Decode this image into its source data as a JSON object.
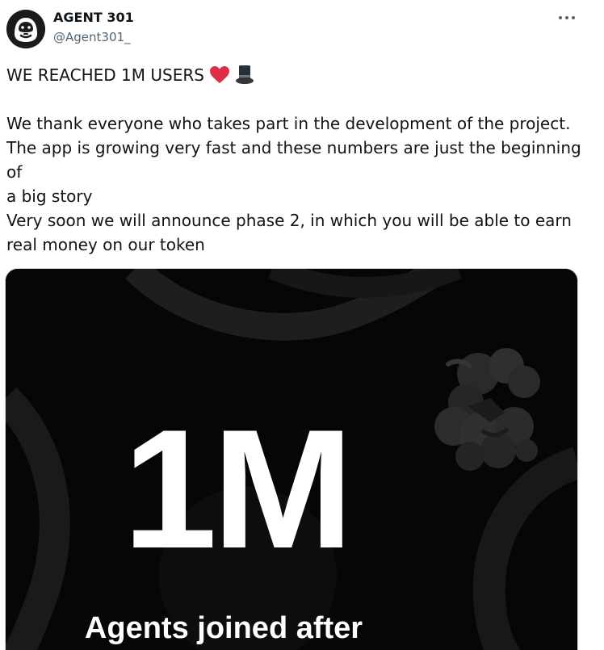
{
  "author": {
    "name": "AGENT 301",
    "handle": "@Agent301_"
  },
  "more_icon": "more-horizontal-icon",
  "post": {
    "headline": "WE REACHED 1M USERS",
    "headline_emojis": [
      "red-heart-icon",
      "top-hat-icon"
    ],
    "paragraph_1": "We thank everyone who takes part in the development of the project.\nThe app is growing very fast and these numbers are just the beginning of\na big story",
    "paragraph_2": "Very soon we will announce phase 2, in which you will be able to earn\nreal money on our token"
  },
  "media": {
    "big_stat": "1M",
    "caption": "Agents joined after",
    "background_color": "#060606"
  },
  "colors": {
    "text": "#0f1419",
    "secondary": "#536471",
    "heart": "#e0245e"
  }
}
